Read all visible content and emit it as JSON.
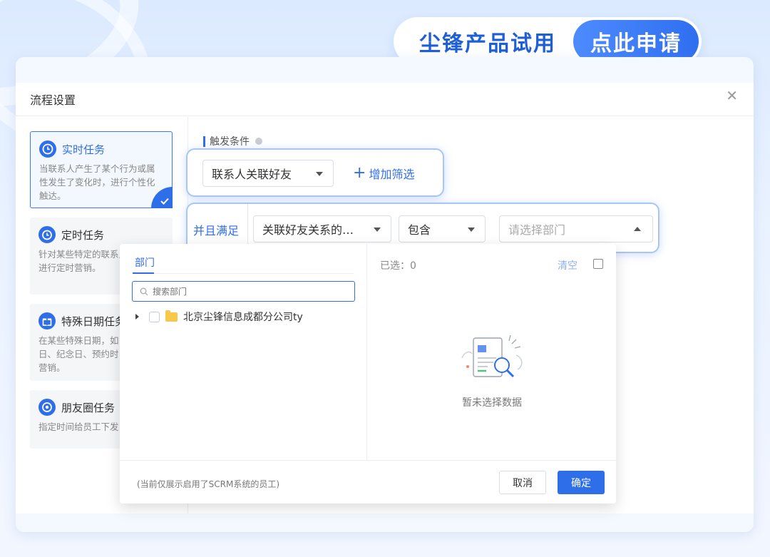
{
  "banner": {
    "title": "尘锋产品试用",
    "apply_button": "点此申请"
  },
  "dialog": {
    "title": "流程设置",
    "tasks": [
      {
        "title": "实时任务",
        "desc": "当联系人产生了某个行为或属\n性发生了变化时，进行个性化\n触达。"
      },
      {
        "title": "定时任务",
        "desc": "针对某些特定的联系人\n进行定时营销。"
      },
      {
        "title": "特殊日期任务",
        "desc": "在某些特殊日期，如\n日、纪念日、预约时\n营销。"
      },
      {
        "title": "朋友圈任务",
        "desc": "指定时间给员工下发"
      }
    ],
    "trigger_label": "触发条件",
    "trigger_select": "联系人关联好友",
    "add_filter": "增加筛选",
    "logic_label": "并且满足",
    "condition_field": "关联好友关系的…",
    "condition_operator": "包含",
    "condition_value_placeholder": "请选择部门"
  },
  "dropdown": {
    "tab": "部门",
    "search_placeholder": "搜索部门",
    "tree_item": "北京尘锋信息成都分公司ty",
    "selected_label": "已选：0",
    "clear": "清空",
    "empty_text": "暂未选择数据",
    "footer_note": "(当前仅展示启用了SCRM系统的员工)",
    "cancel": "取消",
    "confirm": "确定"
  },
  "colors": {
    "accent": "#2f6ee9",
    "highlight_border": "#a7c5f5"
  }
}
